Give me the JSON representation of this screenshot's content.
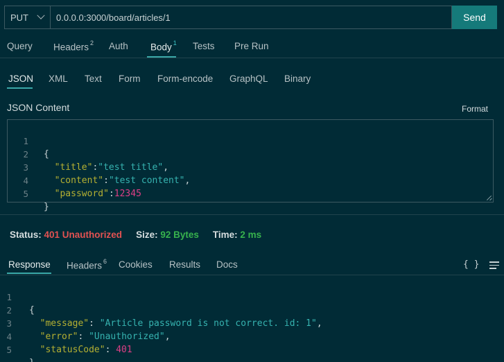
{
  "request": {
    "method": "PUT",
    "url": "0.0.0.0:3000/board/articles/1",
    "send_label": "Send"
  },
  "request_tabs": [
    {
      "label": "Query",
      "badge": ""
    },
    {
      "label": "Headers",
      "badge": "2"
    },
    {
      "label": "Auth",
      "badge": ""
    },
    {
      "label": "Body",
      "badge": "1"
    },
    {
      "label": "Tests",
      "badge": ""
    },
    {
      "label": "Pre Run",
      "badge": ""
    }
  ],
  "body_types": [
    "JSON",
    "XML",
    "Text",
    "Form",
    "Form-encode",
    "GraphQL",
    "Binary"
  ],
  "json_content": {
    "title": "JSON Content",
    "format_label": "Format",
    "line_numbers": [
      "1",
      "2",
      "3",
      "4",
      "5"
    ],
    "lines": [
      {
        "plain": "{"
      },
      {
        "indent": "  ",
        "key": "\"title\"",
        "sep": ":",
        "value": "\"test title\"",
        "tail": ","
      },
      {
        "indent": "  ",
        "key": "\"content\"",
        "sep": ":",
        "value": "\"test content\"",
        "tail": ","
      },
      {
        "indent": "  ",
        "key": "\"password\"",
        "sep": ":",
        "number": "12345"
      },
      {
        "plain": "}"
      }
    ]
  },
  "status": {
    "status_label": "Status:",
    "status_value": "401 Unauthorized",
    "size_label": "Size:",
    "size_value": "92 Bytes",
    "time_label": "Time:",
    "time_value": "2 ms"
  },
  "response_tabs": [
    {
      "label": "Response",
      "badge": ""
    },
    {
      "label": "Headers",
      "badge": "6"
    },
    {
      "label": "Cookies",
      "badge": ""
    },
    {
      "label": "Results",
      "badge": ""
    },
    {
      "label": "Docs",
      "badge": ""
    }
  ],
  "response_braces_label": "{ }",
  "response": {
    "line_numbers": [
      "1",
      "2",
      "3",
      "4",
      "5"
    ],
    "lines": [
      {
        "plain": "{"
      },
      {
        "indent": "  ",
        "key": "\"message\"",
        "sep": ": ",
        "value": "\"Article password is not correct. id: 1\"",
        "tail": ","
      },
      {
        "indent": "  ",
        "key": "\"error\"",
        "sep": ": ",
        "value": "\"Unauthorized\"",
        "tail": ","
      },
      {
        "indent": "  ",
        "key": "\"statusCode\"",
        "sep": ": ",
        "number": "401"
      },
      {
        "plain": "}"
      }
    ]
  },
  "colors": {
    "background": "#012b36",
    "accent": "#157a7a",
    "status_error": "#e35252",
    "status_ok": "#37b24d",
    "json_key": "#b5b032",
    "json_string": "#36b3b0",
    "json_number": "#dd3f86"
  }
}
